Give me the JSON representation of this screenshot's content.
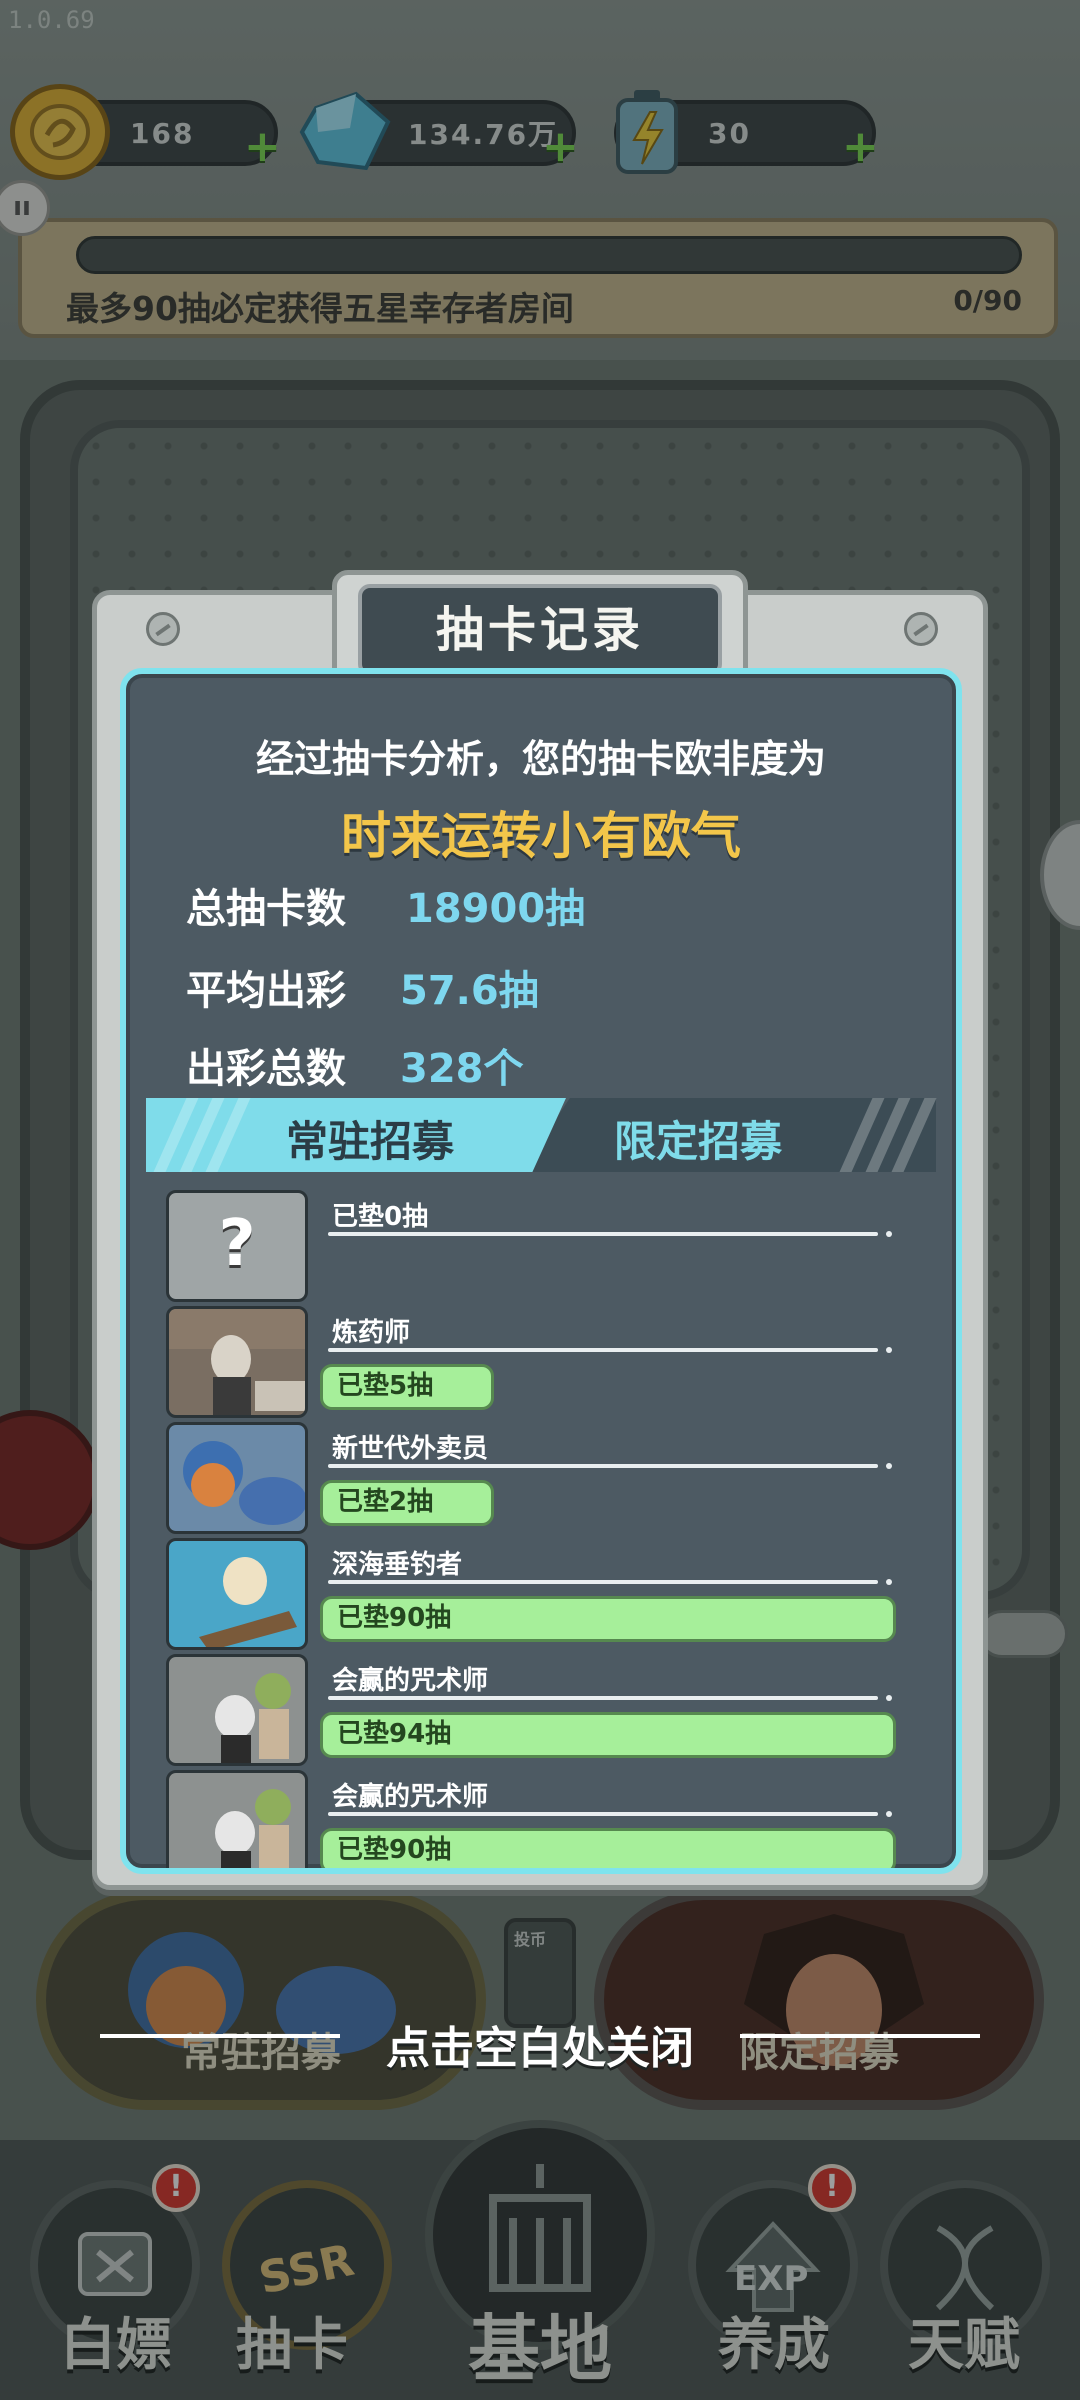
{
  "app": {
    "version": "1.0.69"
  },
  "resources": [
    {
      "name": "gold-coin",
      "value": "168"
    },
    {
      "name": "diamond",
      "value": "134.76万"
    },
    {
      "name": "energy-battery",
      "value": "30"
    }
  ],
  "pity": {
    "caption": "最多90抽必定获得五星幸存者房间",
    "count": "0/90",
    "progress_fraction": 0
  },
  "modal": {
    "title": "抽卡记录",
    "analysis": "经过抽卡分析，您的抽卡欧非度为",
    "verdict": "时来运转小有欧气",
    "stats": [
      {
        "label": "总抽卡数",
        "value": "18900抽"
      },
      {
        "label": "平均出彩",
        "value": "57.6抽"
      },
      {
        "label": "出彩总数",
        "value": "328个"
      }
    ],
    "tabs": [
      {
        "label": "常驻招募",
        "active": true
      },
      {
        "label": "限定招募",
        "active": false
      }
    ],
    "records": [
      {
        "name": "已垫0抽",
        "pill": "",
        "pill_level": "short"
      },
      {
        "name": "炼药师",
        "pill": "已垫5抽",
        "pill_level": "short"
      },
      {
        "name": "新世代外卖员",
        "pill": "已垫2抽",
        "pill_level": "short"
      },
      {
        "name": "深海垂钓者",
        "pill": "已垫90抽",
        "pill_level": "long"
      },
      {
        "name": "会赢的咒术师",
        "pill": "已垫94抽",
        "pill_level": "long"
      },
      {
        "name": "会赢的咒术师",
        "pill": "已垫90抽",
        "pill_level": "long"
      }
    ],
    "unknown_thumb": "?"
  },
  "recruit": {
    "standard_label": "常驻招募",
    "limited_label": "限定招募",
    "coin_slot_label": "投币",
    "close_hint": "点击空白处关闭"
  },
  "nav": [
    {
      "label": "白嫖",
      "icon": "ticket-icon",
      "badge": "!"
    },
    {
      "label": "抽卡",
      "icon": "ssr-icon",
      "badge": ""
    },
    {
      "label": "基地",
      "icon": "base-icon",
      "badge": ""
    },
    {
      "label": "养成",
      "icon": "exp-icon",
      "badge": "!"
    },
    {
      "label": "天赋",
      "icon": "dna-icon",
      "badge": ""
    }
  ],
  "colors": {
    "panel": "#4d5a63",
    "panel_border": "#7fe3ee",
    "verdict": "#f3c64a",
    "stat_value": "#7ed7ef",
    "pill": "#a6ef9a"
  }
}
